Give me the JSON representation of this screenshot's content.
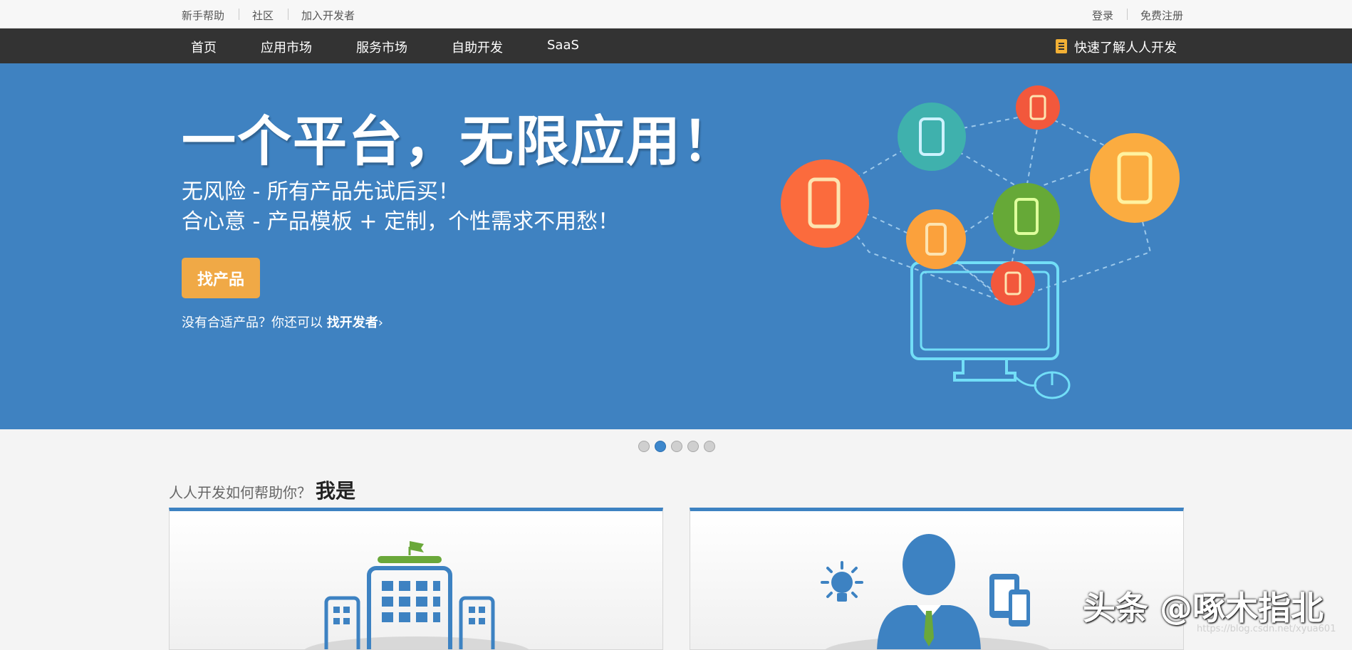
{
  "topbar": {
    "left_links": [
      "新手帮助",
      "社区",
      "加入开发者"
    ],
    "login": "登录",
    "register": "免费注册"
  },
  "nav": {
    "items": [
      "首页",
      "应用市场",
      "服务市场",
      "自助开发",
      "SaaS"
    ],
    "quick_link": "快速了解人人开发",
    "quick_icon": "book-icon"
  },
  "hero": {
    "title": "一个平台，无限应用！",
    "line1": "无风险 - 所有产品先试后买！",
    "line2": "合心意 - 产品模板 + 定制，个性需求不用愁！",
    "button": "找产品",
    "note_prefix": "没有合适产品？你还可以 ",
    "note_link": "找开发者",
    "note_arrow": "›",
    "bg_color": "#3f82c1",
    "button_color": "#f0a946"
  },
  "carousel": {
    "count": 5,
    "active_index": 1
  },
  "help": {
    "question": "人人开发如何帮助你？",
    "me": "我是"
  },
  "cards": [
    {
      "icon": "enterprise-building-icon"
    },
    {
      "icon": "developer-person-icon"
    }
  ],
  "watermark": {
    "text": "头条 @啄木指北",
    "url": "https://blog.csdn.net/xyua601"
  }
}
